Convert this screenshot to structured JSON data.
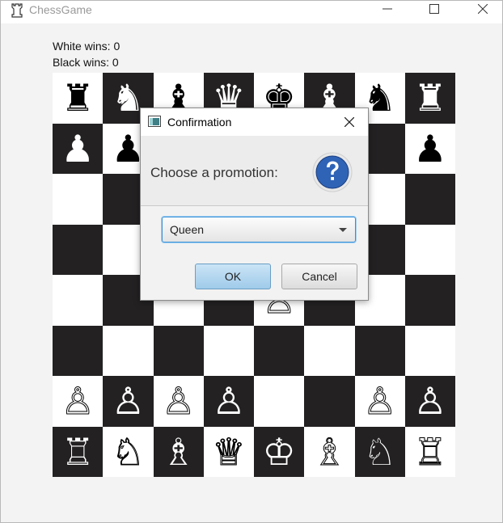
{
  "window": {
    "title": "ChessGame"
  },
  "stats": {
    "white_wins": "White wins: 0",
    "black_wins": "Black wins: 0"
  },
  "board": {
    "rows": [
      [
        "♜",
        "♞",
        "♝",
        "♛",
        "♚",
        "♝",
        "♞",
        "♜"
      ],
      [
        "♟",
        "♟",
        "",
        "",
        "",
        "",
        "",
        "♟"
      ],
      [
        "",
        "",
        "",
        "",
        "",
        "",
        "",
        ""
      ],
      [
        "",
        "",
        "",
        "",
        "",
        "",
        "",
        ""
      ],
      [
        "",
        "",
        "",
        "",
        "♙",
        "",
        "",
        ""
      ],
      [
        "",
        "",
        "",
        "",
        "",
        "",
        "",
        ""
      ],
      [
        "♙",
        "♙",
        "♙",
        "♙",
        "",
        "",
        "♙",
        "♙"
      ],
      [
        "♖",
        "♘",
        "♗",
        "♕",
        "♔",
        "♗",
        "♘",
        "♖"
      ]
    ]
  },
  "dialog": {
    "title": "Confirmation",
    "header_text": "Choose a promotion:",
    "combo_value": "Queen",
    "ok_label": "OK",
    "cancel_label": "Cancel"
  },
  "colors": {
    "dark_square": "#232122",
    "light_square": "#ffffff",
    "accent": "#3a8fd6",
    "ok_button": "#b5d8f1"
  }
}
